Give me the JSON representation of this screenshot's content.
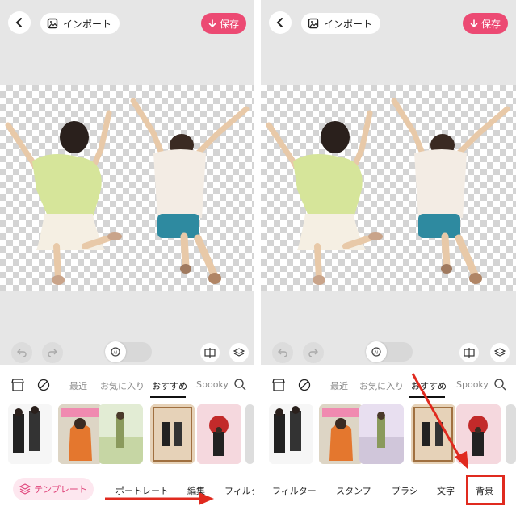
{
  "editor": {
    "import_label": "インポート",
    "save_label": "保存",
    "accent_color": "#ec4a73"
  },
  "tabs": {
    "recent": "最近",
    "favorites": "お気に入り",
    "recommended": "おすすめ",
    "spooky": "Spooky"
  },
  "left_nav": {
    "template": "テンプレート",
    "portrait": "ポートレート",
    "edit": "編集",
    "filter": "フィルタ"
  },
  "right_nav": {
    "filter": "フィルター",
    "stamp": "スタンプ",
    "brush": "ブラシ",
    "text": "文字",
    "background": "背景"
  },
  "icons": [
    "back-icon",
    "image-icon",
    "download-icon",
    "undo-icon",
    "redo-icon",
    "ai-icon",
    "compare-icon",
    "layers-icon",
    "store-icon",
    "none-icon",
    "search-icon",
    "template-icon"
  ],
  "annotation_color": "#e02a1f"
}
